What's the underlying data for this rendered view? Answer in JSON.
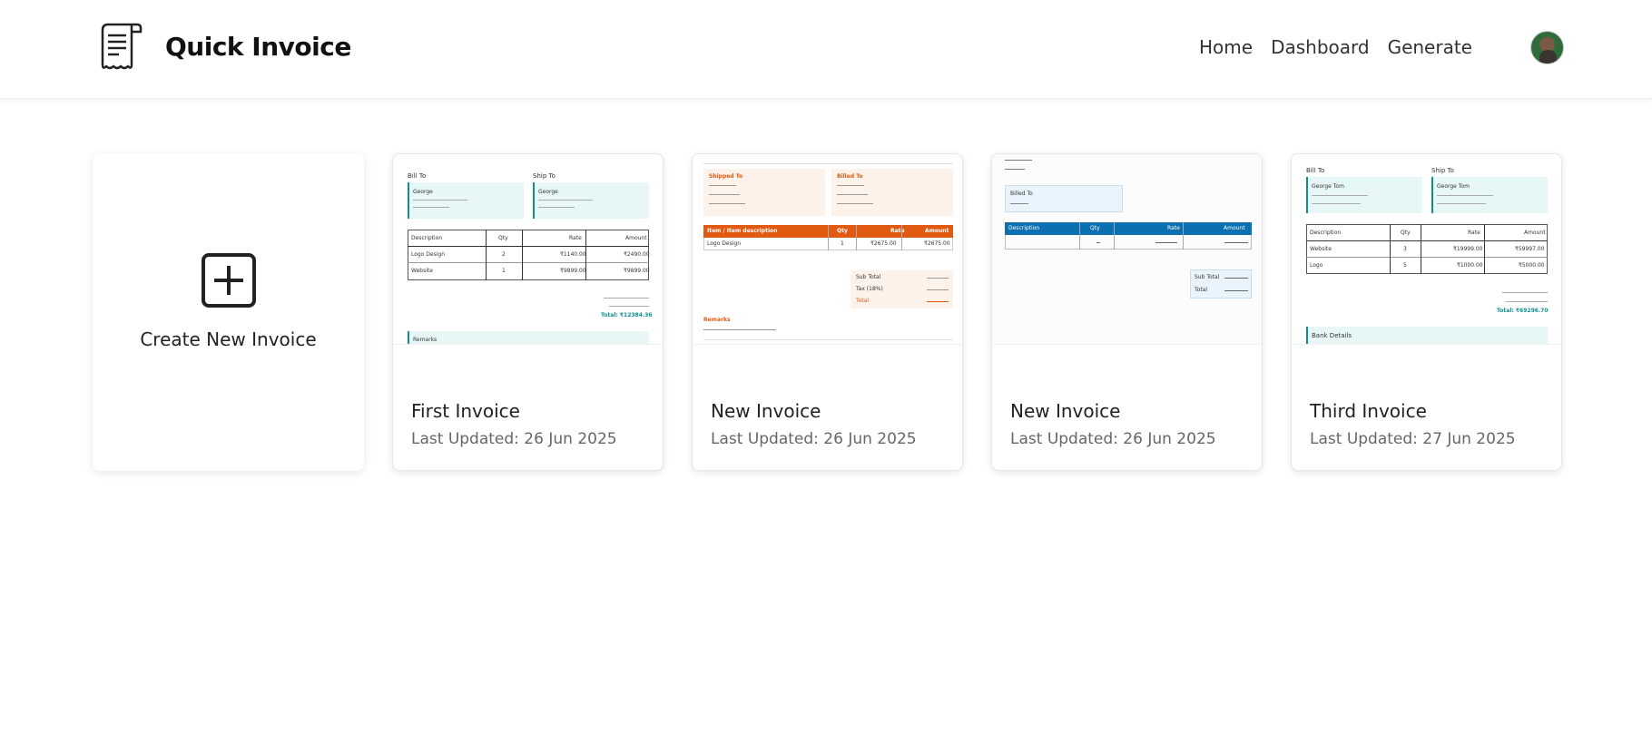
{
  "header": {
    "brand": "Quick Invoice",
    "nav": {
      "home": "Home",
      "dashboard": "Dashboard",
      "generate": "Generate"
    }
  },
  "create_card": {
    "label": "Create New Invoice"
  },
  "invoices": [
    {
      "title": "First Invoice",
      "updated": "Last Updated: 26 Jun 2025",
      "preview": {
        "bill_to": "Bill To",
        "ship_to": "Ship To",
        "bill_name": "George",
        "ship_name": "George",
        "columns": [
          "Description",
          "Qty",
          "Rate",
          "Amount"
        ],
        "rows": [
          [
            "Logo Design",
            "2",
            "₹1140.00",
            "₹2490.00"
          ],
          [
            "Website",
            "1",
            "₹9899.00",
            "₹9899.00"
          ]
        ],
        "total": "Total: ₹12384.36",
        "remarks": "Remarks"
      }
    },
    {
      "title": "New Invoice",
      "updated": "Last Updated: 26 Jun 2025",
      "preview": {
        "shipped_to": "Shipped To",
        "billed_to": "Billed To",
        "columns": [
          "Item / Item description",
          "Qty",
          "Rate",
          "Amount"
        ],
        "row": [
          "Logo Design",
          "1",
          "₹2675.00",
          "₹2675.00"
        ],
        "sub_total": "Sub Total",
        "tax": "Tax (18%)",
        "total": "Total",
        "remarks": "Remarks"
      }
    },
    {
      "title": "New Invoice",
      "updated": "Last Updated: 26 Jun 2025",
      "preview": {
        "billed_to": "Billed To",
        "columns": [
          "Description",
          "Qty",
          "Rate",
          "Amount"
        ],
        "sub_total": "Sub Total",
        "total": "Total"
      }
    },
    {
      "title": "Third Invoice",
      "updated": "Last Updated: 27 Jun 2025",
      "preview": {
        "bill_to": "Bill To",
        "ship_to": "Ship To",
        "bill_name": "George Tom",
        "ship_name": "George Tom",
        "columns": [
          "Description",
          "Qty",
          "Rate",
          "Amount"
        ],
        "rows": [
          [
            "Website",
            "3",
            "₹19999.00",
            "₹59997.00"
          ],
          [
            "Logo",
            "5",
            "₹1000.00",
            "₹5000.00"
          ]
        ],
        "total": "Total: ₹69296.70",
        "bank": "Bank Details"
      }
    }
  ],
  "colors": {
    "teal": "#0e8f8f",
    "teal_bg": "#e6f7f6",
    "orange": "#e05a12",
    "orange_bg": "#fdf2ea",
    "blue": "#0b6fb0",
    "blue_bg": "#eaf4fd"
  },
  "icons": {
    "logo": "receipt-icon",
    "create": "plus-square-icon",
    "avatar": "user-avatar"
  }
}
